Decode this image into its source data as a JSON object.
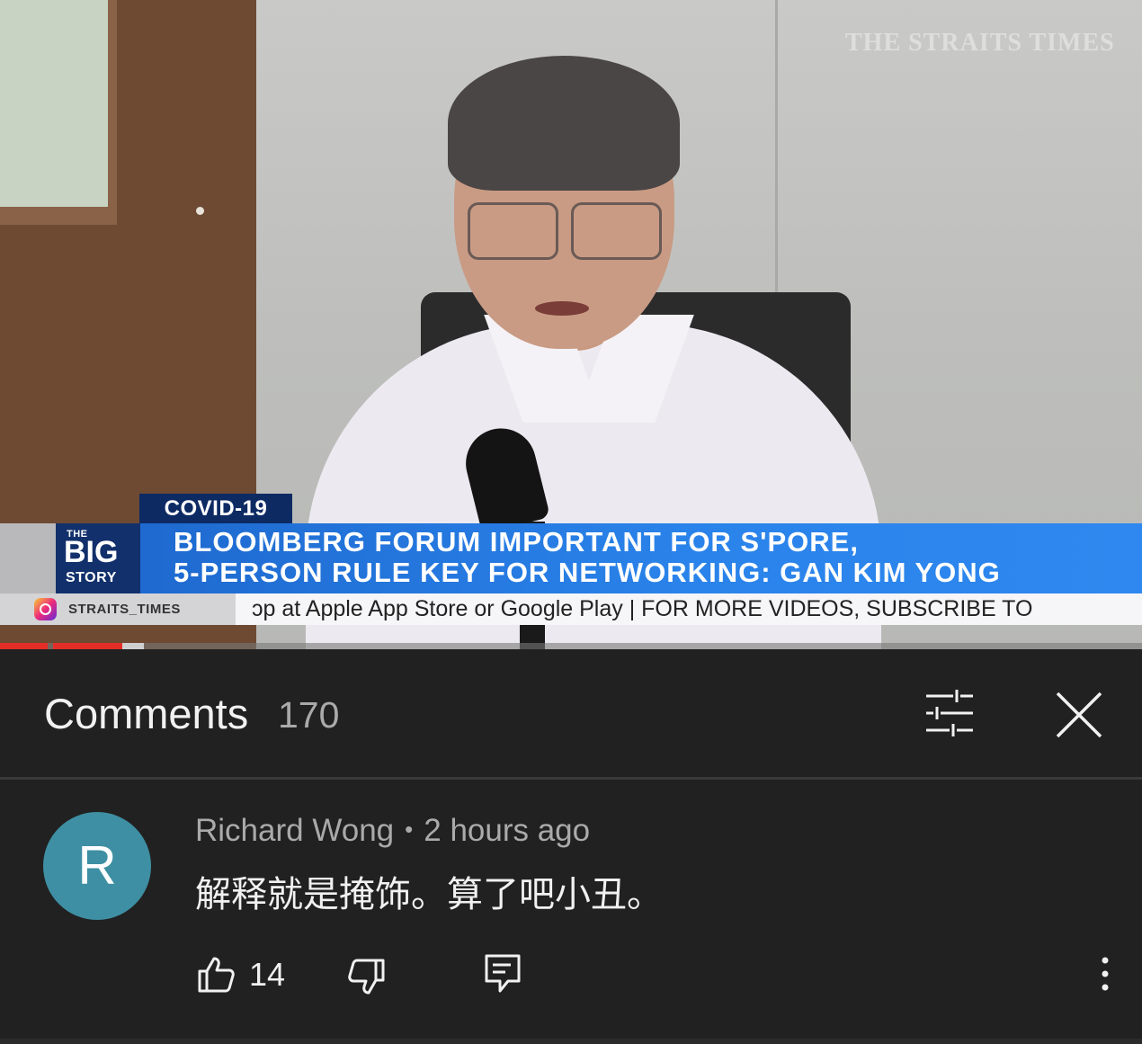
{
  "video": {
    "watermark": "THE STRAITS TIMES",
    "lower_third": {
      "tag": "COVID-19",
      "logo_the": "THE",
      "logo_big": "BIG",
      "logo_story": "STORY",
      "headline_line1": "BLOOMBERG FORUM IMPORTANT FOR S'PORE,",
      "headline_line2": "5-PERSON RULE KEY FOR NETWORKING: GAN KIM YONG"
    },
    "ticker": {
      "handle": "STRAITS_TIMES",
      "text": "ɔp at Apple App Store or Google Play    |    FOR MORE VIDEOS, SUBSCRIBE TO"
    },
    "progress_fraction": 0.107
  },
  "comments": {
    "title": "Comments",
    "count": "170",
    "items": [
      {
        "avatar_letter": "R",
        "avatar_color": "#3e8fa3",
        "author": "Richard Wong",
        "separator": "•",
        "time": "2 hours ago",
        "text": "解释就是掩饰。算了吧小丑。",
        "likes": "14"
      }
    ]
  },
  "icons": {
    "filter": "filter-icon",
    "close": "close-icon",
    "like": "thumbs-up-icon",
    "dislike": "thumbs-down-icon",
    "reply": "reply-icon",
    "more": "more-vertical-icon"
  },
  "colors": {
    "background": "#212121",
    "progress": "#e52d27",
    "text_primary": "#f1f1f1",
    "text_secondary": "#aaaaaa"
  }
}
